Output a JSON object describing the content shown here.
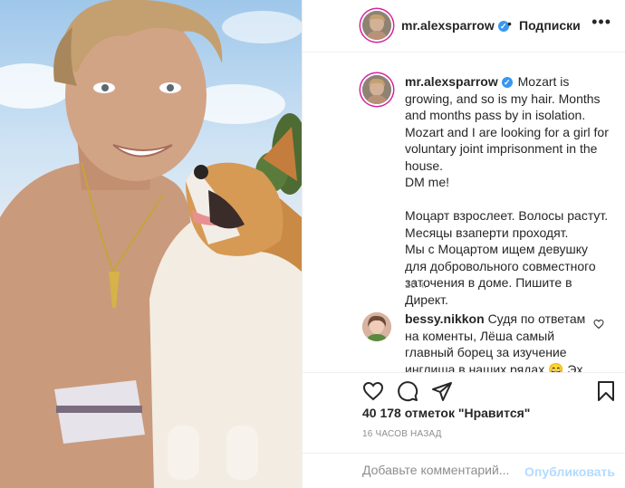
{
  "post": {
    "username": "mr.alexsparrow",
    "verified_icon": "verified-badge-icon",
    "follow_separator": "•",
    "follow_label": "Подписки",
    "more_icon": "more-options-icon",
    "caption": "Mozart is growing, and so is my hair. Months and months pass by in isolation.\nMozart and I are looking for a girl for voluntary joint imprisonment in the house.\nDM me!\n\nМоцарт взрослеет. Волосы растут. Месяцы взаперти проходят.\nМы с Моцартом ищем девушку для добровольного совместного заточения в доме. Пишите в Директ.",
    "time_ago": "16 ч.",
    "photo": "photo of shirtless man with corgi puppy"
  },
  "comments": [
    {
      "username": "bessy.nikkon",
      "text": "Судя по ответам на коменты, Лёша самый главный борец за изучение инглиша в наших рядах 😄 Эх, трахнуться"
    }
  ],
  "actions": {
    "like_icon": "heart-icon",
    "comment_icon": "comment-icon",
    "share_icon": "share-icon",
    "save_icon": "bookmark-icon",
    "likes_text": "40 178 отметок \"Нравится\"",
    "posted_text": "16 ЧАСОВ НАЗАД"
  },
  "comment_box": {
    "placeholder": "Добавьте комментарий...",
    "publish_label": "Опубликовать"
  },
  "colors": {
    "accent_blue": "#0095f6",
    "publish_disabled": "#b3dbff",
    "muted_text": "#8e8e8e",
    "border": "#efefef"
  }
}
